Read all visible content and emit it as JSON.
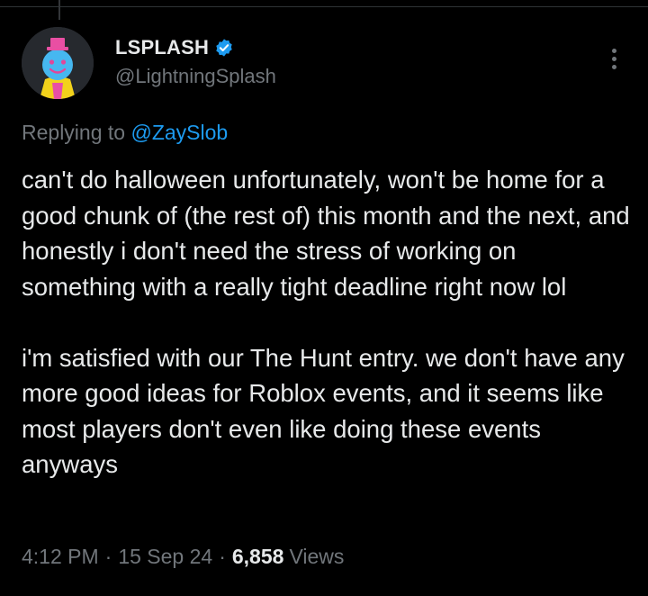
{
  "author": {
    "display_name": "LSPLASH",
    "handle": "@LightningSplash",
    "verified": true
  },
  "reply": {
    "prefix": "Replying to ",
    "mention": "@ZaySlob"
  },
  "tweet": {
    "paragraphs": [
      "can't do halloween unfortunately, won't be home for a good chunk of (the rest of) this month and the next, and honestly i don't need the stress of working on something with a really tight deadline right now lol",
      "i'm satisfied with our The Hunt entry. we don't have any more good ideas for Roblox events, and it seems like most players don't even like doing these events anyways"
    ]
  },
  "meta": {
    "time": "4:12 PM",
    "separator": "·",
    "date": "15 Sep 24",
    "views_count": "6,858",
    "views_label": "Views"
  },
  "colors": {
    "background": "#000000",
    "text": "#e7e9ea",
    "muted": "#71767b",
    "accent": "#1d9bf0"
  },
  "icons": {
    "more": "more-vertical-icon",
    "verified": "verified-badge-icon"
  }
}
